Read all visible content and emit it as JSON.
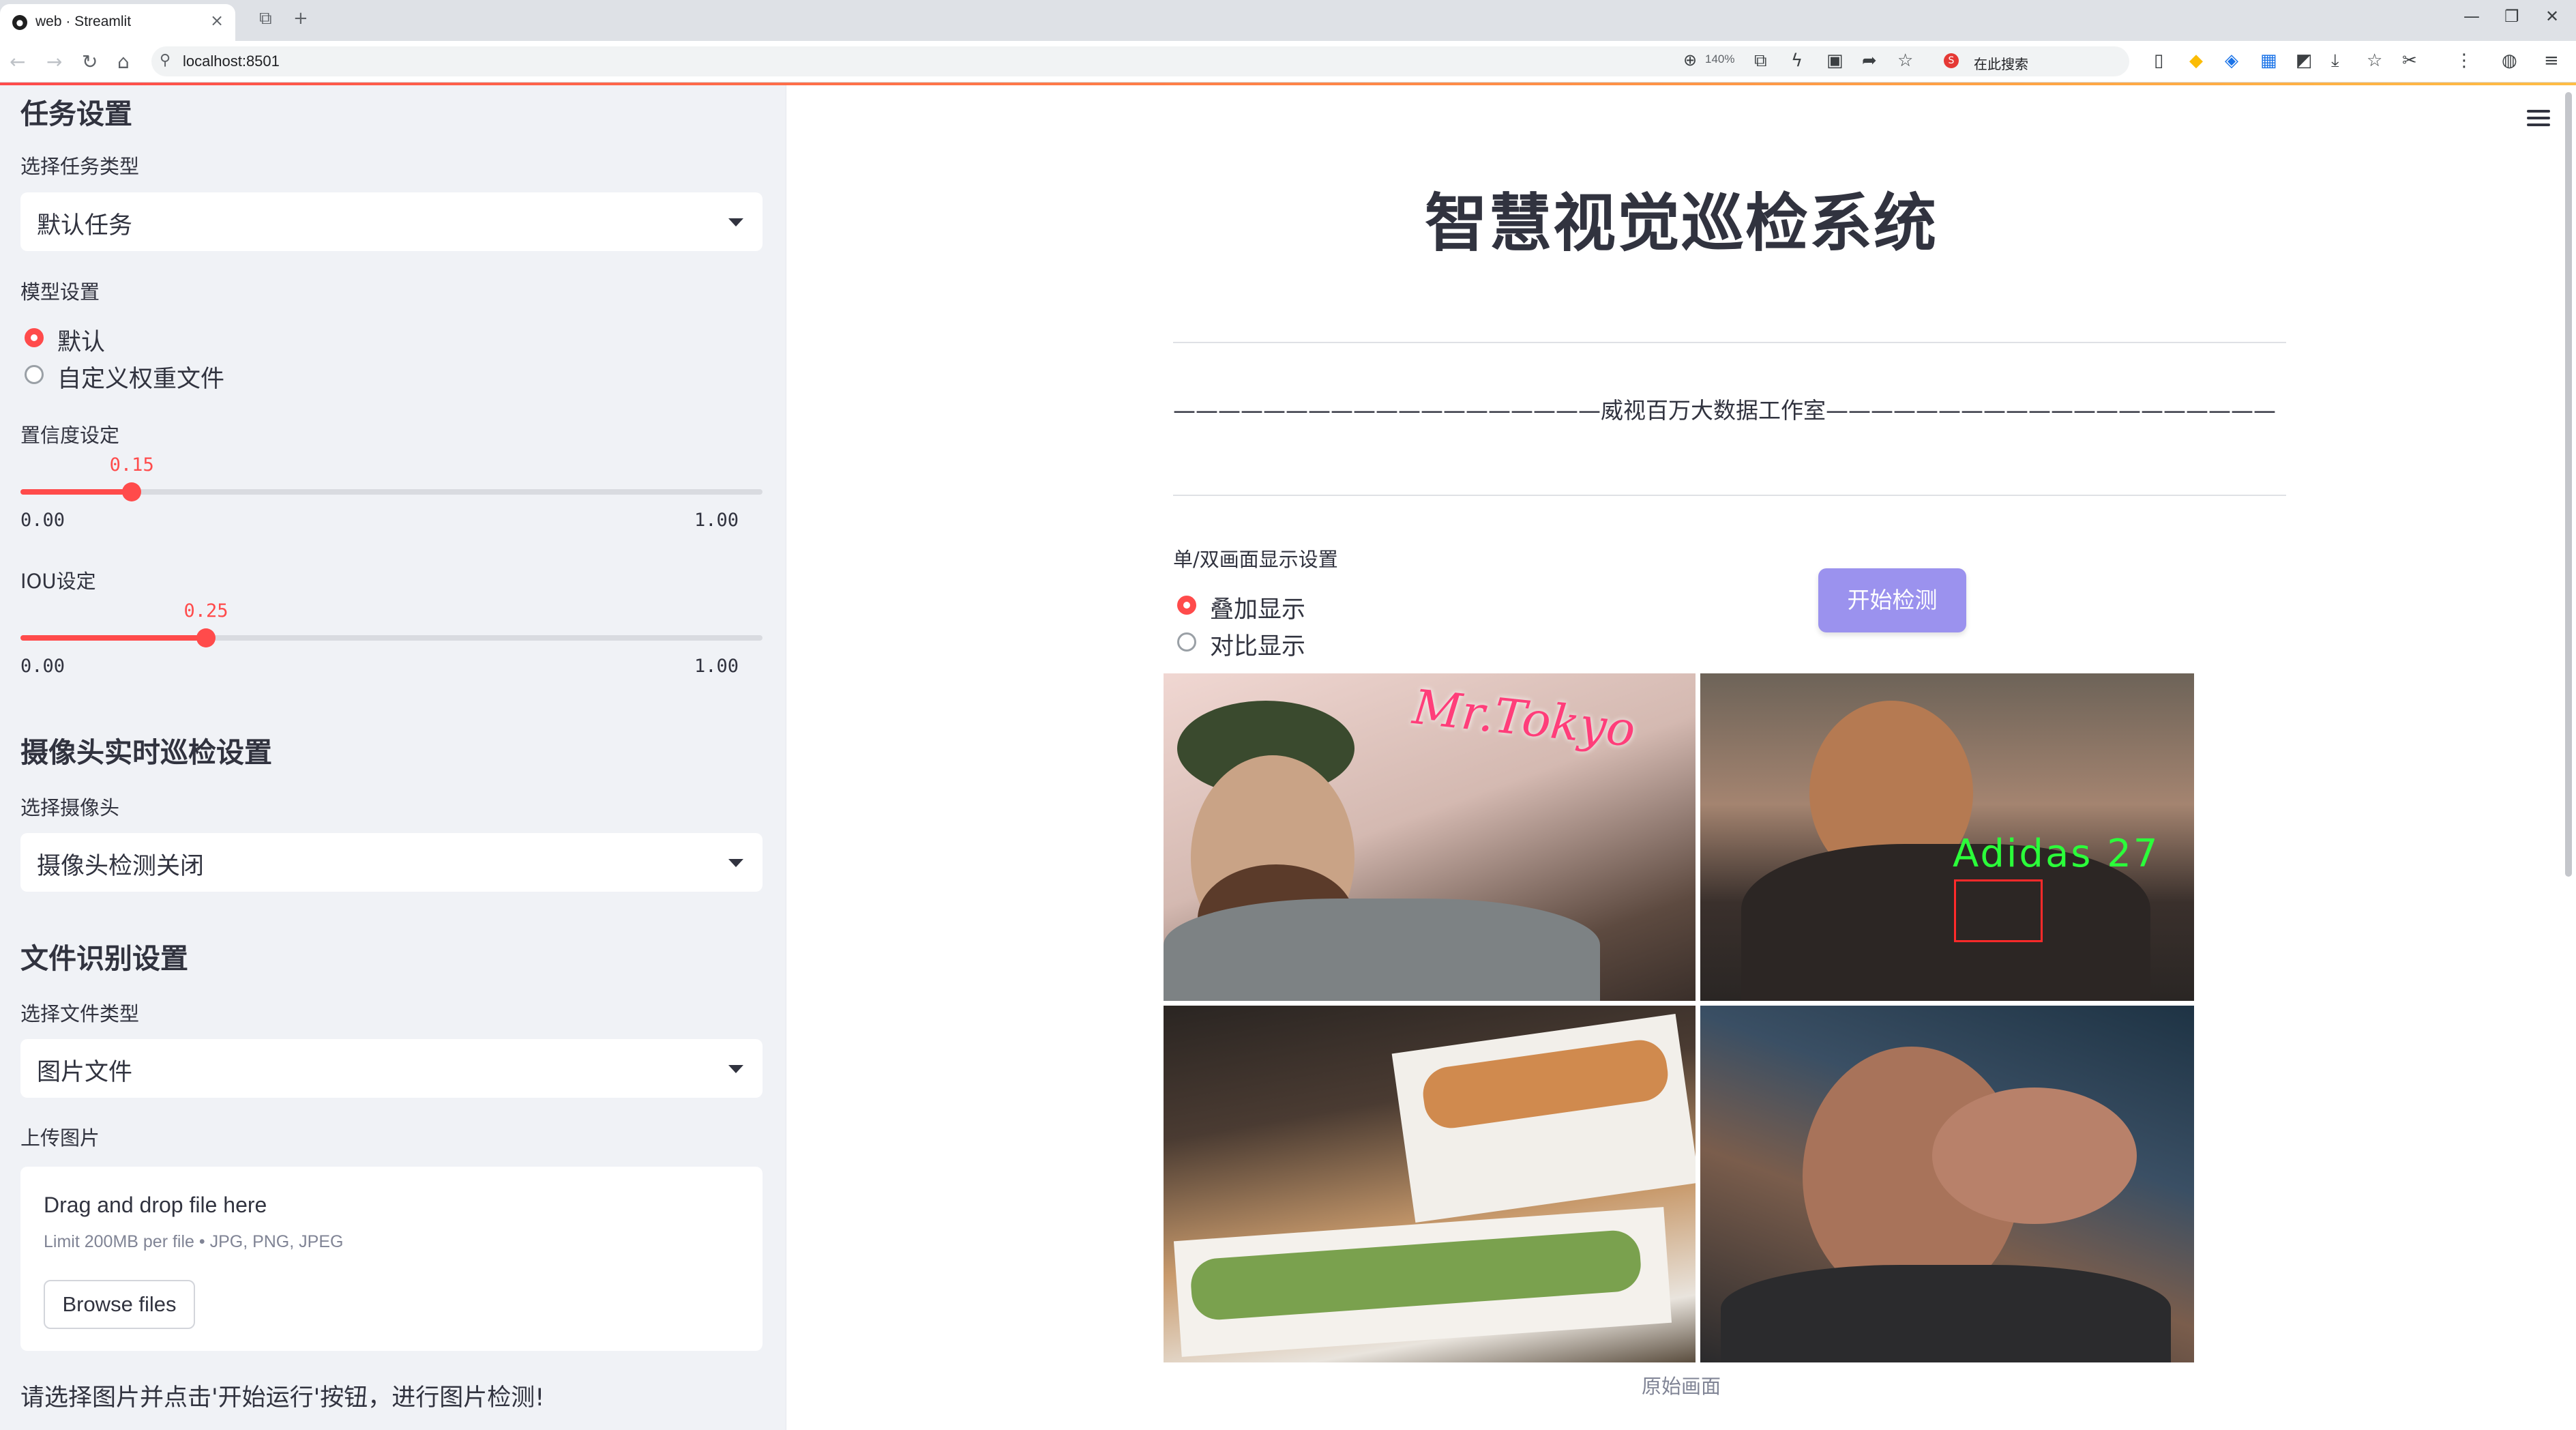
{
  "browser": {
    "tab_title": "web · Streamlit",
    "url": "localhost:8501",
    "zoom": "140%",
    "search_placeholder": "在此搜索"
  },
  "sidebar": {
    "task_section": {
      "heading": "任务设置",
      "task_type_label": "选择任务类型",
      "task_type_value": "默认任务"
    },
    "model_section": {
      "label": "模型设置",
      "options": [
        "默认",
        "自定义权重文件"
      ],
      "selected": "默认"
    },
    "confidence": {
      "label": "置信度设定",
      "value": "0.15",
      "min": "0.00",
      "max": "1.00",
      "fraction": 0.15
    },
    "iou": {
      "label": "IOU设定",
      "value": "0.25",
      "min": "0.00",
      "max": "1.00",
      "fraction": 0.25
    },
    "camera_section": {
      "heading": "摄像头实时巡检设置",
      "label": "选择摄像头",
      "value": "摄像头检测关闭"
    },
    "file_section": {
      "heading": "文件识别设置",
      "label": "选择文件类型",
      "value": "图片文件"
    },
    "upload": {
      "label": "上传图片",
      "title": "Drag and drop file here",
      "limit": "Limit 200MB per file • JPG, PNG, JPEG",
      "button": "Browse files"
    },
    "footer_text": "请选择图片并点击'开始运行'按钮，进行图片检测!"
  },
  "main": {
    "title": "智慧视觉巡检系统",
    "banner": "———————————————————威视百万大数据工作室————————————————————",
    "display_label": "单/双画面显示设置",
    "display_options": [
      "叠加显示",
      "对比显示"
    ],
    "display_selected": "叠加显示",
    "start_button": "开始检测",
    "image_texts": {
      "sign": "Mr.Tokyo",
      "detection_label": "Adidas  27"
    },
    "caption": "原始画面"
  },
  "colors": {
    "accent": "#ff4b4b",
    "button": "#9b92ee",
    "sidebar_bg": "#f0f2f6",
    "detection_text": "#2bff3a",
    "detection_box": "#ff2a2a"
  }
}
